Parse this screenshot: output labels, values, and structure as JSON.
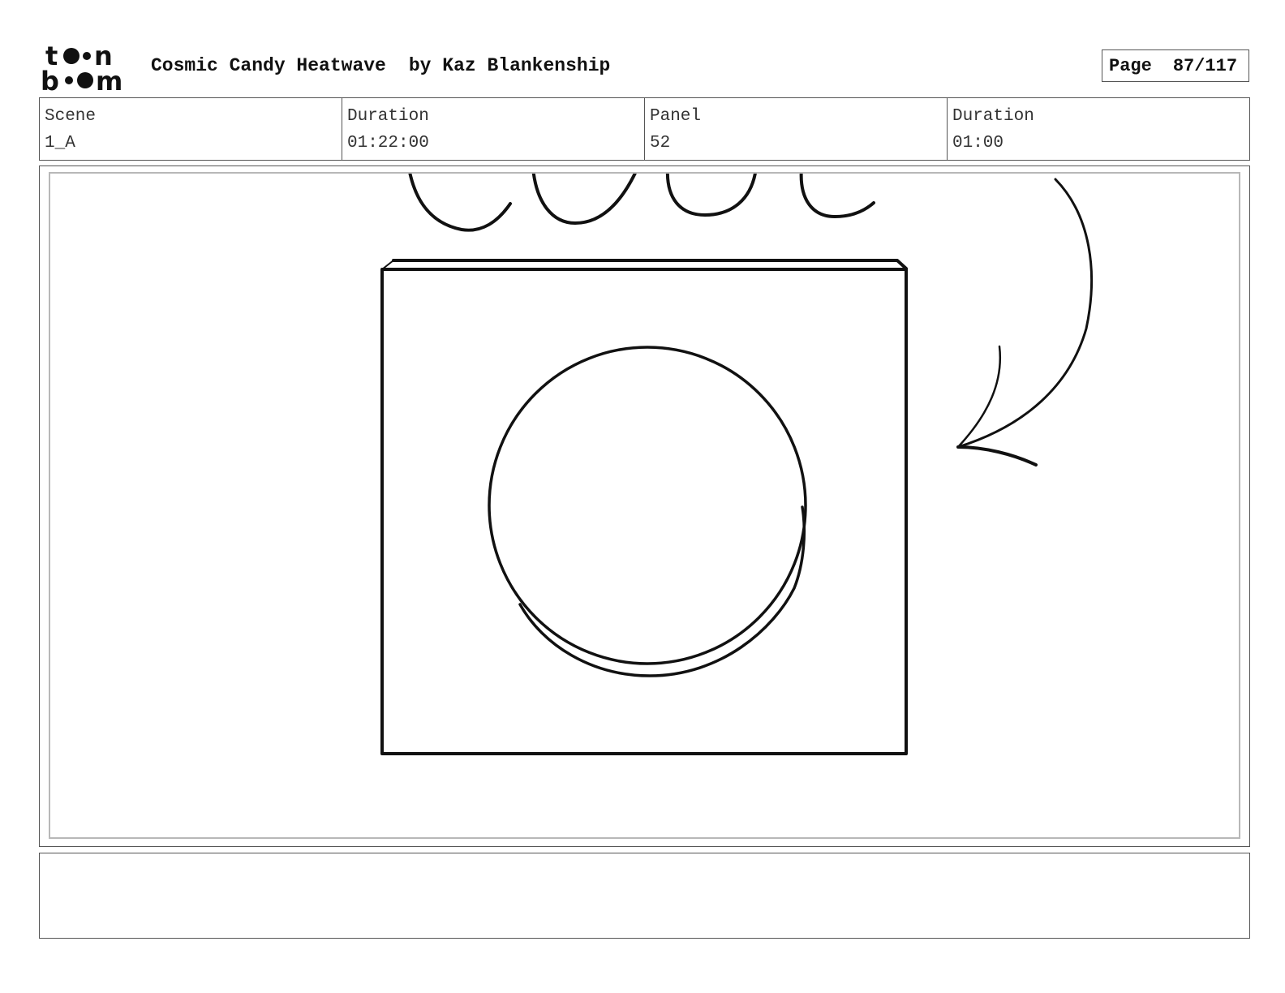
{
  "header": {
    "logo_text": "toon boom",
    "project_title": "Cosmic Candy Heatwave",
    "author": "by Kaz Blankenship",
    "page_label": "Page",
    "page_number": "87/117"
  },
  "info": {
    "scene_label": "Scene",
    "scene_value": "1_A",
    "scene_duration_label": "Duration",
    "scene_duration_value": "01:22:00",
    "panel_label": "Panel",
    "panel_value": "52",
    "panel_duration_label": "Duration",
    "panel_duration_value": "01:00"
  },
  "notes": {
    "text": ""
  }
}
